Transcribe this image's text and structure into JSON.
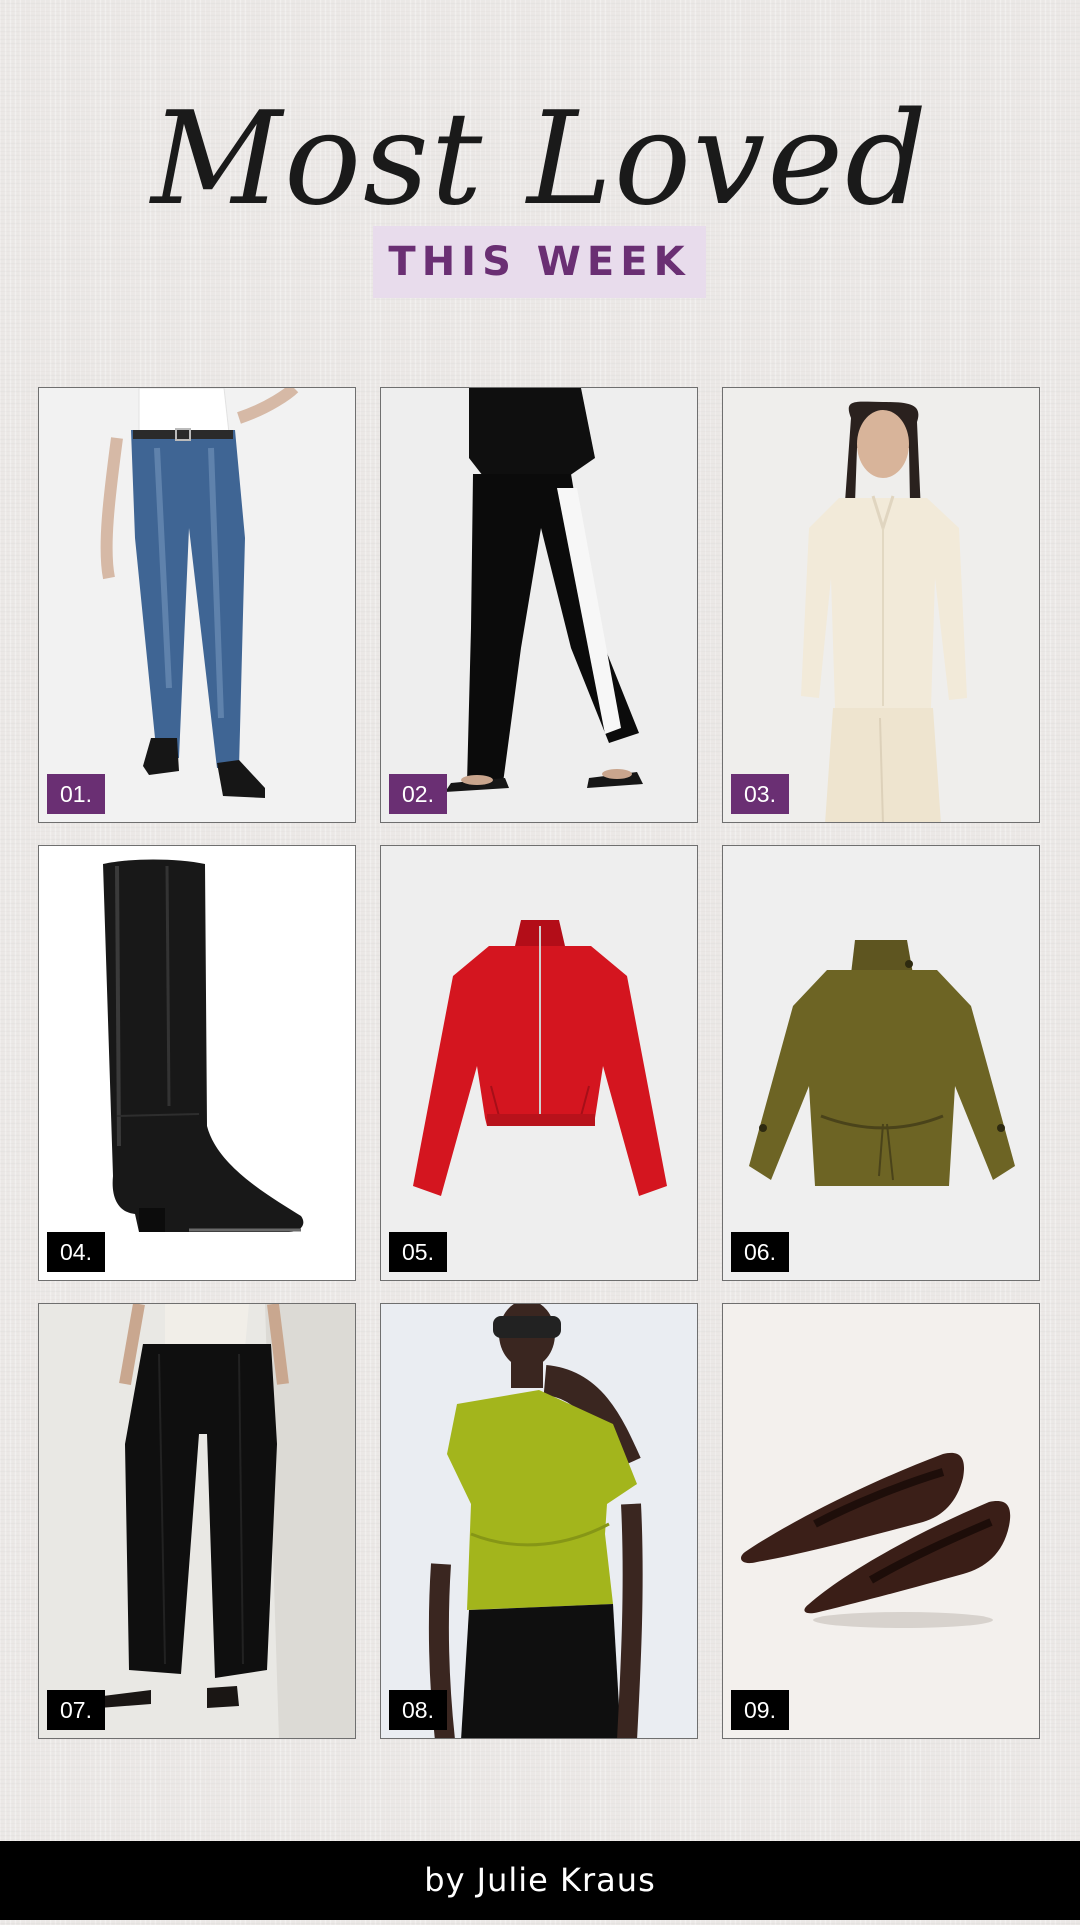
{
  "header": {
    "title": "Most Loved",
    "subtitle": "THIS WEEK"
  },
  "items": [
    {
      "number": "01.",
      "image": "straight-leg-blue-jeans",
      "badge_color": "#6a2f73"
    },
    {
      "number": "02.",
      "image": "black-track-pants-white-stripe",
      "badge_color": "#6a2f73"
    },
    {
      "number": "03.",
      "image": "cream-satin-shirt",
      "badge_color": "#6a2f73"
    },
    {
      "number": "04.",
      "image": "black-knee-high-boot",
      "badge_color": "#000000"
    },
    {
      "number": "05.",
      "image": "red-zip-jacket",
      "badge_color": "#000000"
    },
    {
      "number": "06.",
      "image": "olive-funnel-neck-jacket",
      "badge_color": "#000000"
    },
    {
      "number": "07.",
      "image": "black-barrel-trousers",
      "badge_color": "#000000"
    },
    {
      "number": "08.",
      "image": "chartreuse-one-shoulder-top",
      "badge_color": "#000000"
    },
    {
      "number": "09.",
      "image": "brown-suede-flats",
      "badge_color": "#000000"
    }
  ],
  "footer": {
    "byline": "by Julie Kraus"
  },
  "colors": {
    "accent": "#6a2f73",
    "accent_light": "#e8dcec",
    "footer_bg": "#000000"
  }
}
